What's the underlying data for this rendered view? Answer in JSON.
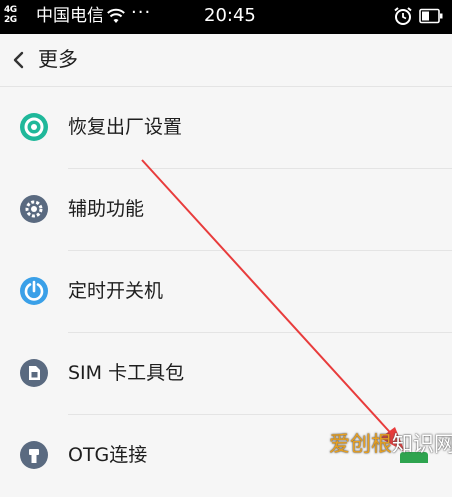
{
  "status_bar": {
    "network_top": "4G",
    "network_bottom": "2G",
    "carrier": "中国电信",
    "more": "···",
    "time": "20:45",
    "wifi_icon": "wifi-icon",
    "alarm_icon": "alarm-icon",
    "battery_icon": "battery-icon"
  },
  "header": {
    "back_icon": "chevron-left-icon",
    "title": "更多"
  },
  "items": [
    {
      "label": "恢复出厂设置",
      "icon": "factory-reset-icon",
      "color": "#1fb89a"
    },
    {
      "label": "辅助功能",
      "icon": "gear-icon",
      "color": "#5a6a80"
    },
    {
      "label": "定时开关机",
      "icon": "timer-power-icon",
      "color": "#3aa0e8"
    },
    {
      "label": "SIM 卡工具包",
      "icon": "sim-card-icon",
      "color": "#5a6a80"
    },
    {
      "label": "OTG连接",
      "icon": "otg-icon",
      "color": "#5a6a80"
    }
  ],
  "watermark": {
    "accent": "爱创根",
    "rest": "知识网"
  },
  "colors": {
    "background": "#f6f6f6",
    "status_bar": "#000000",
    "annotation_arrow": "#e83c3c"
  }
}
